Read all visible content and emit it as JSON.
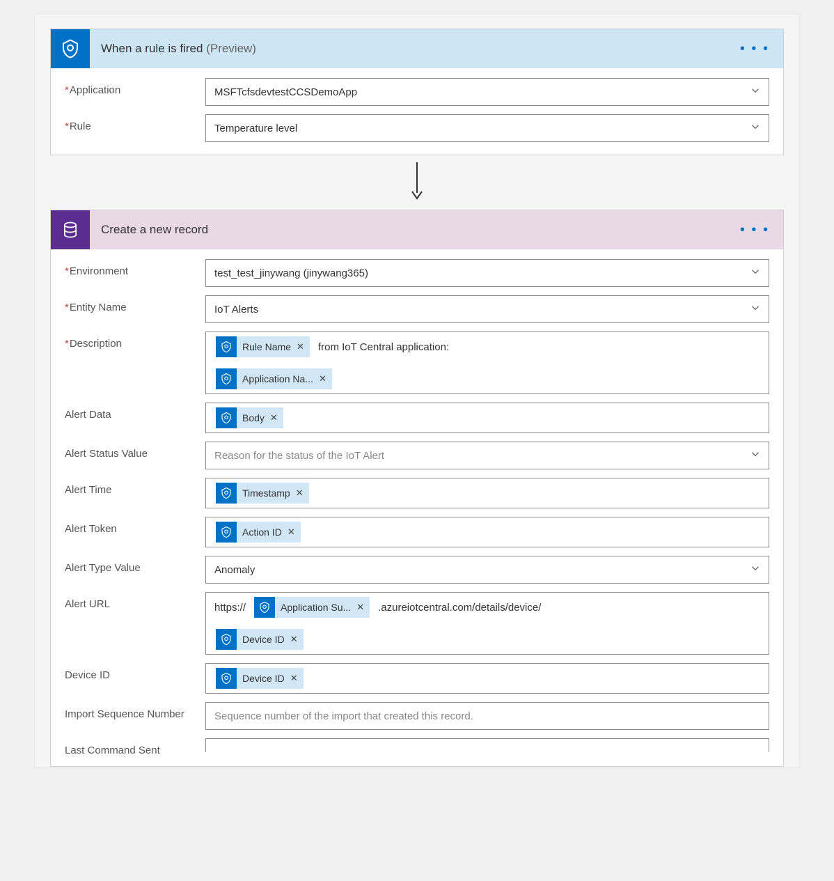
{
  "trigger": {
    "title": "When a rule is fired",
    "preview": "(Preview)",
    "fields": {
      "application": {
        "label": "Application",
        "value": "MSFTcfsdevtestCCSDemoApp"
      },
      "rule": {
        "label": "Rule",
        "value": "Temperature level"
      }
    }
  },
  "action": {
    "title": "Create a new record",
    "fields": {
      "environment": {
        "label": "Environment",
        "value": "test_test_jinywang (jinywang365)"
      },
      "entity": {
        "label": "Entity Name",
        "value": "IoT Alerts"
      },
      "description": {
        "label": "Description",
        "token1": "Rule Name",
        "text1": "from IoT Central application:",
        "token2": "Application Na..."
      },
      "alert_data": {
        "label": "Alert Data",
        "token": "Body"
      },
      "alert_status": {
        "label": "Alert Status Value",
        "placeholder": "Reason for the status of the IoT Alert"
      },
      "alert_time": {
        "label": "Alert Time",
        "token": "Timestamp"
      },
      "alert_token": {
        "label": "Alert Token",
        "token": "Action ID"
      },
      "alert_type": {
        "label": "Alert Type Value",
        "value": "Anomaly"
      },
      "alert_url": {
        "label": "Alert URL",
        "text1": "https://",
        "token1": "Application Su...",
        "text2": ".azureiotcentral.com/details/device/",
        "token2": "Device ID"
      },
      "device_id": {
        "label": "Device ID",
        "token": "Device ID"
      },
      "import_seq": {
        "label": "Import Sequence Number",
        "placeholder": "Sequence number of the import that created this record."
      },
      "last_cmd": {
        "label": "Last Command Sent"
      }
    }
  }
}
